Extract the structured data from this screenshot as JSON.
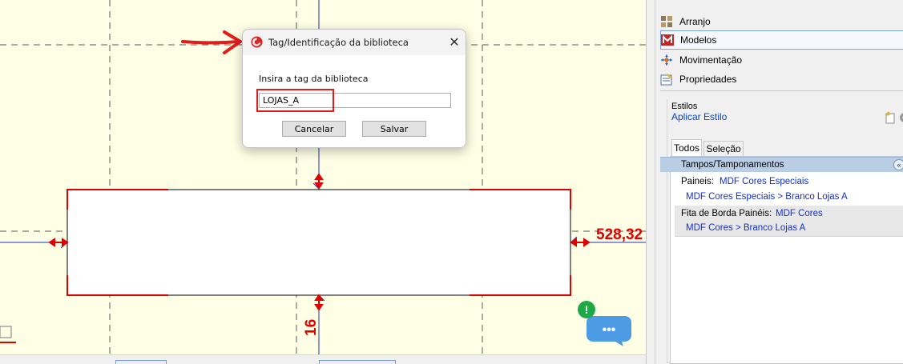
{
  "dialog": {
    "title": "Tag/Identificação da biblioteca",
    "close_glyph": "✕",
    "prompt": "Insira a tag da biblioteca",
    "tag_value": "LOJAS_A",
    "cancel_label": "Cancelar",
    "save_label": "Salvar"
  },
  "canvas": {
    "dimension_right": "528,32",
    "dimension_bottom": "16"
  },
  "panel": {
    "nav": [
      {
        "label": "Arranjo",
        "icon": "arrange-icon"
      },
      {
        "label": "Modelos",
        "icon": "models-icon"
      },
      {
        "label": "Movimentação",
        "icon": "move-icon"
      },
      {
        "label": "Propriedades",
        "icon": "properties-icon"
      }
    ],
    "active_nav": "Modelos",
    "styles_label": "Estilos",
    "apply_style": "Aplicar Estilo",
    "tabs": [
      "Todos",
      "Seleção"
    ],
    "active_tab": "Todos",
    "category": "Tampos/Tamponamentos",
    "collapse_glyph": "«",
    "rows": [
      {
        "label": "Paineis:",
        "value": "MDF Cores Especiais",
        "detail": "MDF Cores Especiais > Branco Lojas A"
      },
      {
        "label": "Fita de Borda Painéis:",
        "value": "MDF Cores",
        "detail": "MDF Cores > Branco Lojas A"
      }
    ]
  },
  "chat": {
    "badge": "!",
    "dots": "•••"
  },
  "colors": {
    "canvas_bg": "#ffffe6",
    "drawing_red": "#e00000",
    "annotation_red": "#e31b1b",
    "link_blue": "#1330d0",
    "category_bg": "#b9cde5",
    "chat_blue": "#4d9be3",
    "badge_green": "#1fa847"
  }
}
